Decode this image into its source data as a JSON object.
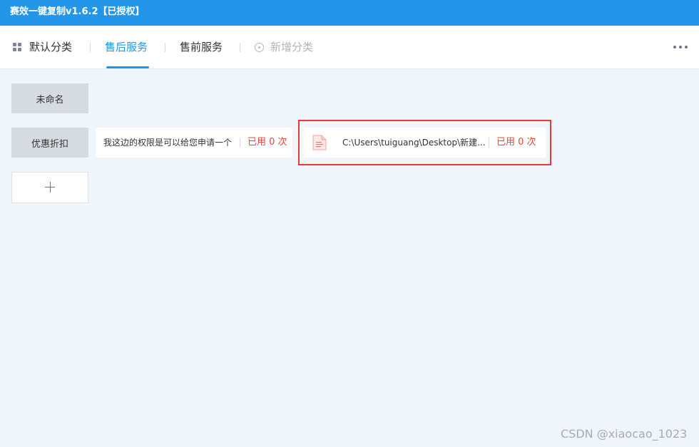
{
  "window": {
    "title": "赛效一键复制v1.6.2【已授权】"
  },
  "tabs": [
    {
      "label": "默认分类",
      "icon": "grid-icon"
    },
    {
      "label": "售后服务",
      "active": true
    },
    {
      "label": "售前服务"
    },
    {
      "label": "新增分类",
      "icon": "plus-circle-icon"
    }
  ],
  "more_icon": "more-icon",
  "categories": [
    {
      "label": "未命名"
    },
    {
      "label": "优惠折扣"
    }
  ],
  "items": [
    {
      "text": "我这边的权限是可以给您申请一个",
      "usage": "已用 0 次"
    },
    {
      "text": "C:\\Users\\tuiguang\\Desktop\\新建...",
      "usage": "已用 0 次",
      "icon": "file-icon"
    }
  ],
  "colors": {
    "accent": "#2396ea",
    "usage": "#e8473d",
    "highlight": "#e53935"
  },
  "watermark": "CSDN @xiaocao_1023"
}
